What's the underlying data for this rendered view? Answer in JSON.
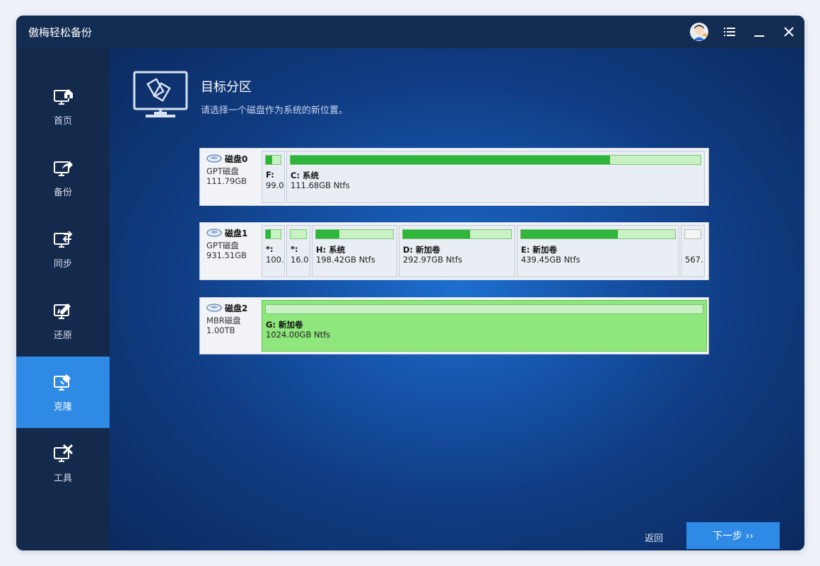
{
  "app": {
    "title": "傲梅轻松备份"
  },
  "titlebar": {
    "avatar_icon": "user-avatar-icon",
    "menu_icon": "menu-icon",
    "minimize_icon": "minimize-icon",
    "close_icon": "close-icon"
  },
  "sidebar": {
    "items": [
      {
        "label": "首页",
        "icon": "home-monitor-icon",
        "active": false
      },
      {
        "label": "备份",
        "icon": "backup-monitor-icon",
        "active": false
      },
      {
        "label": "同步",
        "icon": "sync-monitor-icon",
        "active": false
      },
      {
        "label": "还原",
        "icon": "restore-monitor-icon",
        "active": false
      },
      {
        "label": "克隆",
        "icon": "clone-monitor-icon",
        "active": true
      },
      {
        "label": "工具",
        "icon": "tools-monitor-icon",
        "active": false
      }
    ]
  },
  "header": {
    "title": "目标分区",
    "subtitle": "请选择一个磁盘作为系统的新位置。"
  },
  "disks": [
    {
      "name": "磁盘0",
      "type": "GPT磁盘",
      "size": "111.79GB",
      "partitions": [
        {
          "label": "F:",
          "info": "99.0",
          "used_fraction": 0.45
        },
        {
          "label": "C: 系统",
          "info": "111.68GB Ntfs",
          "used_fraction": 0.78
        }
      ]
    },
    {
      "name": "磁盘1",
      "type": "GPT磁盘",
      "size": "931.51GB",
      "partitions": [
        {
          "label": "*:",
          "info": "100.",
          "used_fraction": 0.35
        },
        {
          "label": "*:",
          "info": "16.0",
          "used_fraction": 0.0
        },
        {
          "label": "H: 系统",
          "info": "198.42GB Ntfs",
          "used_fraction": 0.3
        },
        {
          "label": "D: 新加卷",
          "info": "292.97GB Ntfs",
          "used_fraction": 0.62
        },
        {
          "label": "E: 新加卷",
          "info": "439.45GB Ntfs",
          "used_fraction": 0.63
        },
        {
          "label": "",
          "info": "567.",
          "used_fraction": 0.0
        }
      ]
    },
    {
      "name": "磁盘2",
      "type": "MBR磁盘",
      "size": "1.00TB",
      "partitions": [
        {
          "label": "G: 新加卷",
          "info": "1024.00GB Ntfs",
          "used_fraction": 0.0,
          "selected": true
        }
      ]
    }
  ],
  "footer": {
    "back_label": "返回",
    "next_label": "下一步 ››"
  },
  "colors": {
    "accent": "#2f8ae6",
    "used": "#2eb53a",
    "selected": "#8fe67d"
  }
}
